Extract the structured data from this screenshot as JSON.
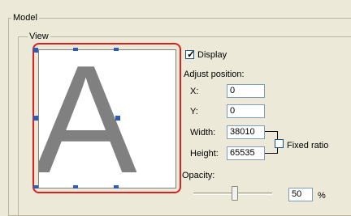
{
  "model": {
    "legend": "Model"
  },
  "view": {
    "legend": "View"
  },
  "preview": {
    "glyph": "A"
  },
  "display": {
    "label": "Display",
    "checked": true
  },
  "adjust_position": {
    "title": "Adjust position:",
    "x_label": "X:",
    "x_value": "0",
    "y_label": "Y:",
    "y_value": "0",
    "width_label": "Width:",
    "width_value": "38010",
    "height_label": "Height:",
    "height_value": "65535",
    "fixed_ratio_label": "Fixed ratio",
    "fixed_ratio_checked": false
  },
  "opacity": {
    "label": "Opacity:",
    "value": "50",
    "unit": "%",
    "level": 0.5
  },
  "colors": {
    "highlight": "#e0201c",
    "handle": "#2a5cb8",
    "glyph": "#808080"
  }
}
